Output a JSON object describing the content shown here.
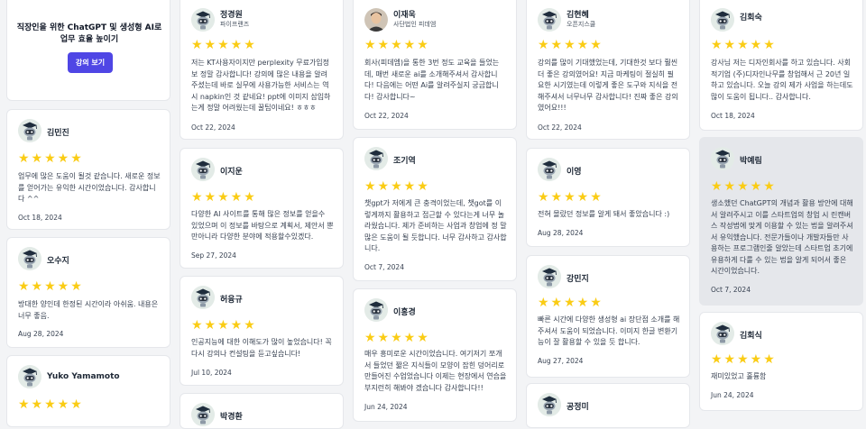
{
  "promo": {
    "title": "직장인을 위한 ChatGPT 및 생성형 AI로 업무 효율 높이기",
    "button_label": "강의 보기"
  },
  "colors": {
    "accent": "#4f46e5",
    "star": "#facc15",
    "highlight_card": "#e5e7eb"
  },
  "icons": {
    "star": "star-icon",
    "avatar": "robot-avatar-icon",
    "photo": "profile-photo"
  },
  "reviews": {
    "kimminjin": {
      "name": "김민진",
      "stars": "★★★★★",
      "rating": 5,
      "text": "업무에 많은 도움이 될것 같습니다. 새로운 정보를 얻어가는 유익한 시간이었습니다. 감사합니다 ^^",
      "date": "Oct 18, 2024"
    },
    "ohsuji": {
      "name": "오수지",
      "stars": "★★★★★",
      "rating": 5,
      "text": "방대한 양인데 한정된 시간이라 아쉬움. 내용은 너무 좋음.",
      "date": "Aug 28, 2024"
    },
    "yuko": {
      "name": "Yuko Yamamoto",
      "stars": "★★★★★",
      "rating": 5
    },
    "jeongwon": {
      "name": "정경원",
      "company": "파이프랜즈",
      "stars": "★★★★★",
      "rating": 5,
      "text": "저는 KT사용자이지만 perplexity 무료가입정보 정말 감사합니다! 강의에 많은 내용을 알려주셨는데 바로 실무에 사용가능한 서비스는 역시 napkin인 것 같네요! ppt에 이미지 삽입하는게 정말 어려웠는데 꿀팁이네요! ㅎㅎㅎ",
      "date": "Oct 22, 2024"
    },
    "ijiun": {
      "name": "이지운",
      "stars": "★★★★★",
      "rating": 5,
      "text": "다양한 AI 사이트를 통해 많은 정보를 얻을수 있었으며 이 정보를 바탕으로 계획서, 제안서 뿐 만아니라 다양한 분야에 적용할수있겠다.",
      "date": "Sep 27, 2024"
    },
    "heoyunggyu": {
      "name": "허융규",
      "stars": "★★★★★",
      "rating": 5,
      "text": "인공지능에 대한 이해도가 많이 높었습니다! 꼭 다시 강의나 컨설팅을 듣고싶습니다!",
      "date": "Jul 10, 2024"
    },
    "bakgyeonghwan": {
      "name": "박경환"
    },
    "ijaeuk": {
      "name": "이재욱",
      "company": "사단법인 피데엠",
      "stars": "★★★★★",
      "rating": 5,
      "text": "회사(피데엠)을 통한 3번 정도 교육을 들었는데, 매번 새로운 ai를 소개해주셔서 감사합니다! 다음에는 어떤 Ai를 알려주실지 궁금합니다! 감사합니다~",
      "date": "Oct 22, 2024"
    },
    "jogiyeok": {
      "name": "조기역",
      "stars": "★★★★★",
      "rating": 5,
      "text": "챗gpt가 저에게 큰 충격이었는데, 챗got를 이렇게까지 활용하고 접근할 수 있다는게 너무 놀라웠습니다. 제가 준비하는 사업과 창업에 정 말 많은 도움이 될 듯합니다. 너무 감사하고 감사합니다.",
      "date": "Oct 7, 2024"
    },
    "ihonggyeong": {
      "name": "이홍경",
      "stars": "★★★★★",
      "rating": 5,
      "text": "매우 흥미로운 시간이었습니다. 여기저기 쪼개서 들었던 짧은 지식들이 모양이 잡힌 덩어리로 만들어진 수업었습니다 이제는 현장에서 연습을 부지런히 해봐야 겠습니다 감사합니다!!",
      "date": "Jun 24, 2024"
    },
    "kimhyeonhye": {
      "name": "김현혜",
      "company": "오픈지스쿨",
      "stars": "★★★★★",
      "rating": 5,
      "text": "강의를 많이 기대했었는데, 기대한것 보다 훨씬 더 좋은 강의였어요! 지금 마케팅이 절실히 필요한 시기였는데 이렇게 좋은 도구와 지식을 전해주셔서 너무너무 감사합니다! 진짜 좋은 강의였어요!!!",
      "date": "Oct 22, 2024"
    },
    "iyeong": {
      "name": "이영",
      "stars": "★★★★★",
      "rating": 5,
      "text": "전혀 몰랐던 정보를 알게 돼서 좋았습니다 :)",
      "date": "Aug 28, 2024"
    },
    "gangminji": {
      "name": "강민지",
      "stars": "★★★★★",
      "rating": 5,
      "text": "빠른 시간에 다양한 생성형 ai 장단점 소개를 해주셔서 도움이 되었습니다. 이미지 한글 변환기능이 잘 활용할 수 있을 듯 합니다.",
      "date": "Aug 27, 2024"
    },
    "gongjeongmi": {
      "name": "공정미"
    },
    "kimhoesuk": {
      "name": "김회숙",
      "stars": "★★★★★",
      "rating": 5,
      "text": "강사님 저는 디자인회사를 하고 있습니다. 사회적기업 (주)디자인나무를 창업해서 근 20년 일하고 있습니다. 오늘 강의 제가 사업을 하는데도 많이 도움이 됩니다.. 감사합니다.",
      "date": "Oct 18, 2024"
    },
    "bakyerim": {
      "name": "박예림",
      "stars": "★★★★★",
      "rating": 5,
      "text": "생소했던 ChatGPT의 개념과 활용 방안에 대해서 알려주시고 이를 스타트업의 창업 시 린캔버스 작성법에 맞게 이용할 수 있는 법을 알려주셔서 유익했습니다. 전문가들이나 개발자들만 사용하는 프로그램인줄 알았는데 스타트업 초기에 유용하게 다룰 수 있는 법을 알게 되어서 좋은 시간이었습니다.",
      "date": "Oct 7, 2024"
    },
    "kimhoesik": {
      "name": "김회식",
      "stars": "★★★★★",
      "rating": 5,
      "text": "재미있었고 훌륭함",
      "date": "Jun 24, 2024"
    }
  }
}
